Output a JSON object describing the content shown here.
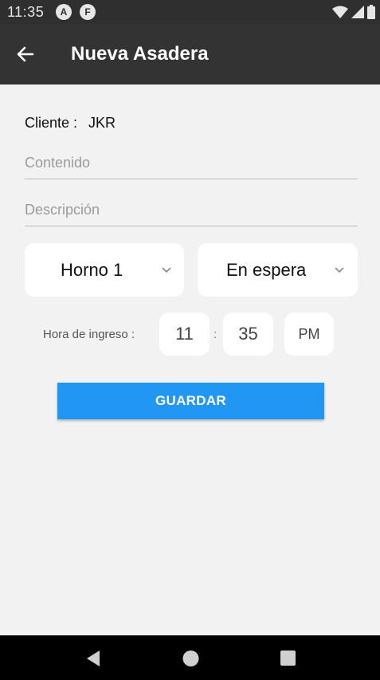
{
  "status_bar": {
    "time": "11:35",
    "app_icon_1": "A",
    "app_icon_2": "F",
    "icons": [
      "wifi-icon",
      "signal-icon",
      "battery-icon"
    ]
  },
  "app_bar": {
    "title": "Nueva Asadera",
    "back_icon": "arrow-left-icon",
    "background": "#333333"
  },
  "client": {
    "label": "Cliente :",
    "value": "JKR"
  },
  "fields": {
    "contenido_placeholder": "Contenido",
    "descripcion_placeholder": "Descripción"
  },
  "selects": {
    "oven": "Horno 1",
    "status": "En espera"
  },
  "time": {
    "label": "Hora de ingreso :",
    "hour": "11",
    "separator": ":",
    "minute": "35",
    "period": "PM"
  },
  "actions": {
    "save_label": "GUARDAR",
    "accent": "#2196f3"
  },
  "nav_bar": {
    "icons": [
      "back-triangle-icon",
      "home-circle-icon",
      "recents-square-icon"
    ]
  }
}
